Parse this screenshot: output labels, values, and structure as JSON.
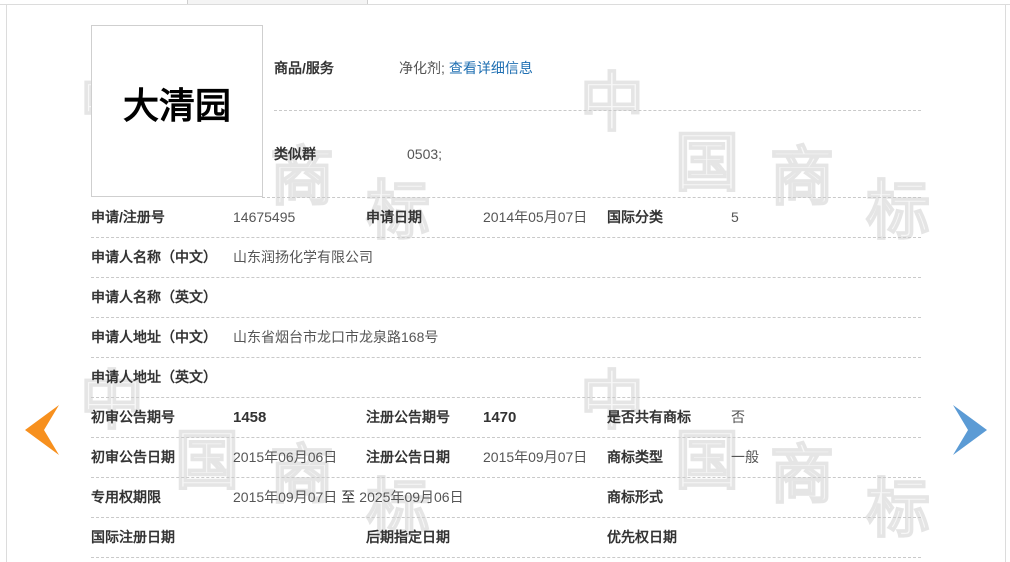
{
  "trademark": {
    "name": "大清园"
  },
  "goods_services": {
    "label": "商品/服务",
    "value": "净化剂;",
    "link": "查看详细信息"
  },
  "similar_group": {
    "label": "类似群",
    "value": "0503;"
  },
  "details": {
    "reg_no": {
      "label": "申请/注册号",
      "value": "14675495"
    },
    "app_date": {
      "label": "申请日期",
      "value": "2014年05月07日"
    },
    "intl_class": {
      "label": "国际分类",
      "value": "5"
    },
    "applicant_name_cn": {
      "label": "申请人名称（中文）",
      "value": "山东润扬化学有限公司"
    },
    "applicant_name_en": {
      "label": "申请人名称（英文）"
    },
    "applicant_addr_cn": {
      "label": "申请人地址（中文）",
      "value": "山东省烟台市龙口市龙泉路168号"
    },
    "applicant_addr_en": {
      "label": "申请人地址（英文）"
    },
    "prelim_pub_no": {
      "label": "初审公告期号",
      "value": "1458"
    },
    "reg_pub_no": {
      "label": "注册公告期号",
      "value": "1470"
    },
    "shared_mark": {
      "label": "是否共有商标",
      "value": "否"
    },
    "prelim_pub_date": {
      "label": "初审公告日期",
      "value": "2015年06月06日"
    },
    "reg_pub_date": {
      "label": "注册公告日期",
      "value": "2015年09月07日"
    },
    "mark_type": {
      "label": "商标类型",
      "value": "一般"
    },
    "exclusive_term": {
      "label": "专用权期限",
      "start": "2015年09月07日",
      "separator": "至",
      "end": "2025年09月06日"
    },
    "mark_form": {
      "label": "商标形式"
    },
    "intl_reg_date": {
      "label": "国际注册日期"
    },
    "later_designation_date": {
      "label": "后期指定日期"
    },
    "priority_date": {
      "label": "优先权日期"
    }
  },
  "watermark": {
    "chars": [
      "中",
      "国",
      "商",
      "标"
    ]
  },
  "icons": {
    "prev": "arrow-left-icon",
    "next": "arrow-right-icon"
  },
  "colors": {
    "link": "#1f6fb2",
    "prev_arrow": "#f7901e",
    "next_arrow": "#5b9bd5",
    "label": "#333333",
    "value": "#555555"
  }
}
